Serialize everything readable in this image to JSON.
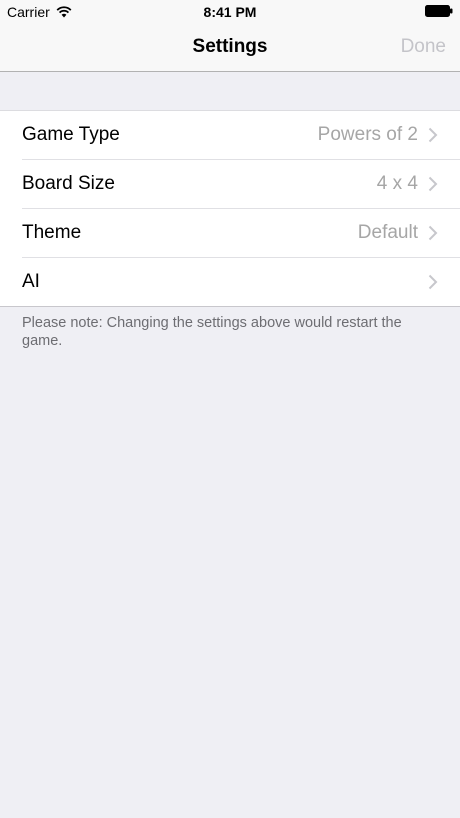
{
  "status_bar": {
    "carrier": "Carrier",
    "time": "8:41 PM"
  },
  "nav": {
    "title": "Settings",
    "done_label": "Done"
  },
  "settings": {
    "rows": [
      {
        "label": "Game Type",
        "value": "Powers of 2"
      },
      {
        "label": "Board Size",
        "value": "4 x 4"
      },
      {
        "label": "Theme",
        "value": "Default"
      },
      {
        "label": "AI",
        "value": ""
      }
    ]
  },
  "footer": {
    "note": "Please note: Changing the settings above would restart the game."
  },
  "icons": {
    "wifi": "wifi-icon",
    "battery": "battery-icon",
    "chevron": "chevron-right-icon"
  },
  "colors": {
    "background": "#efeff4",
    "secondary_text": "#a6a6a6",
    "disabled_button": "#c4c4c9",
    "footer_text": "#6d6d72"
  }
}
